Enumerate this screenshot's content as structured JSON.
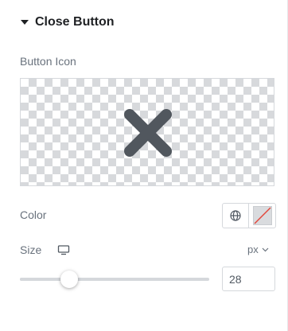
{
  "section": {
    "title": "Close Button",
    "expanded": true
  },
  "button_icon": {
    "label": "Button Icon",
    "icon": "close-x-icon",
    "icon_color": "#51575e"
  },
  "color": {
    "label": "Color",
    "global_icon": "globe-icon",
    "swatch_state": "unset"
  },
  "size": {
    "label": "Size",
    "device_icon": "desktop-icon",
    "unit": "px",
    "value": "28",
    "slider_fraction": 0.26
  },
  "colors": {
    "title": "#1f2124",
    "label": "#69727d",
    "border": "#d5d8dc",
    "unset_slash": "#e2483d"
  }
}
